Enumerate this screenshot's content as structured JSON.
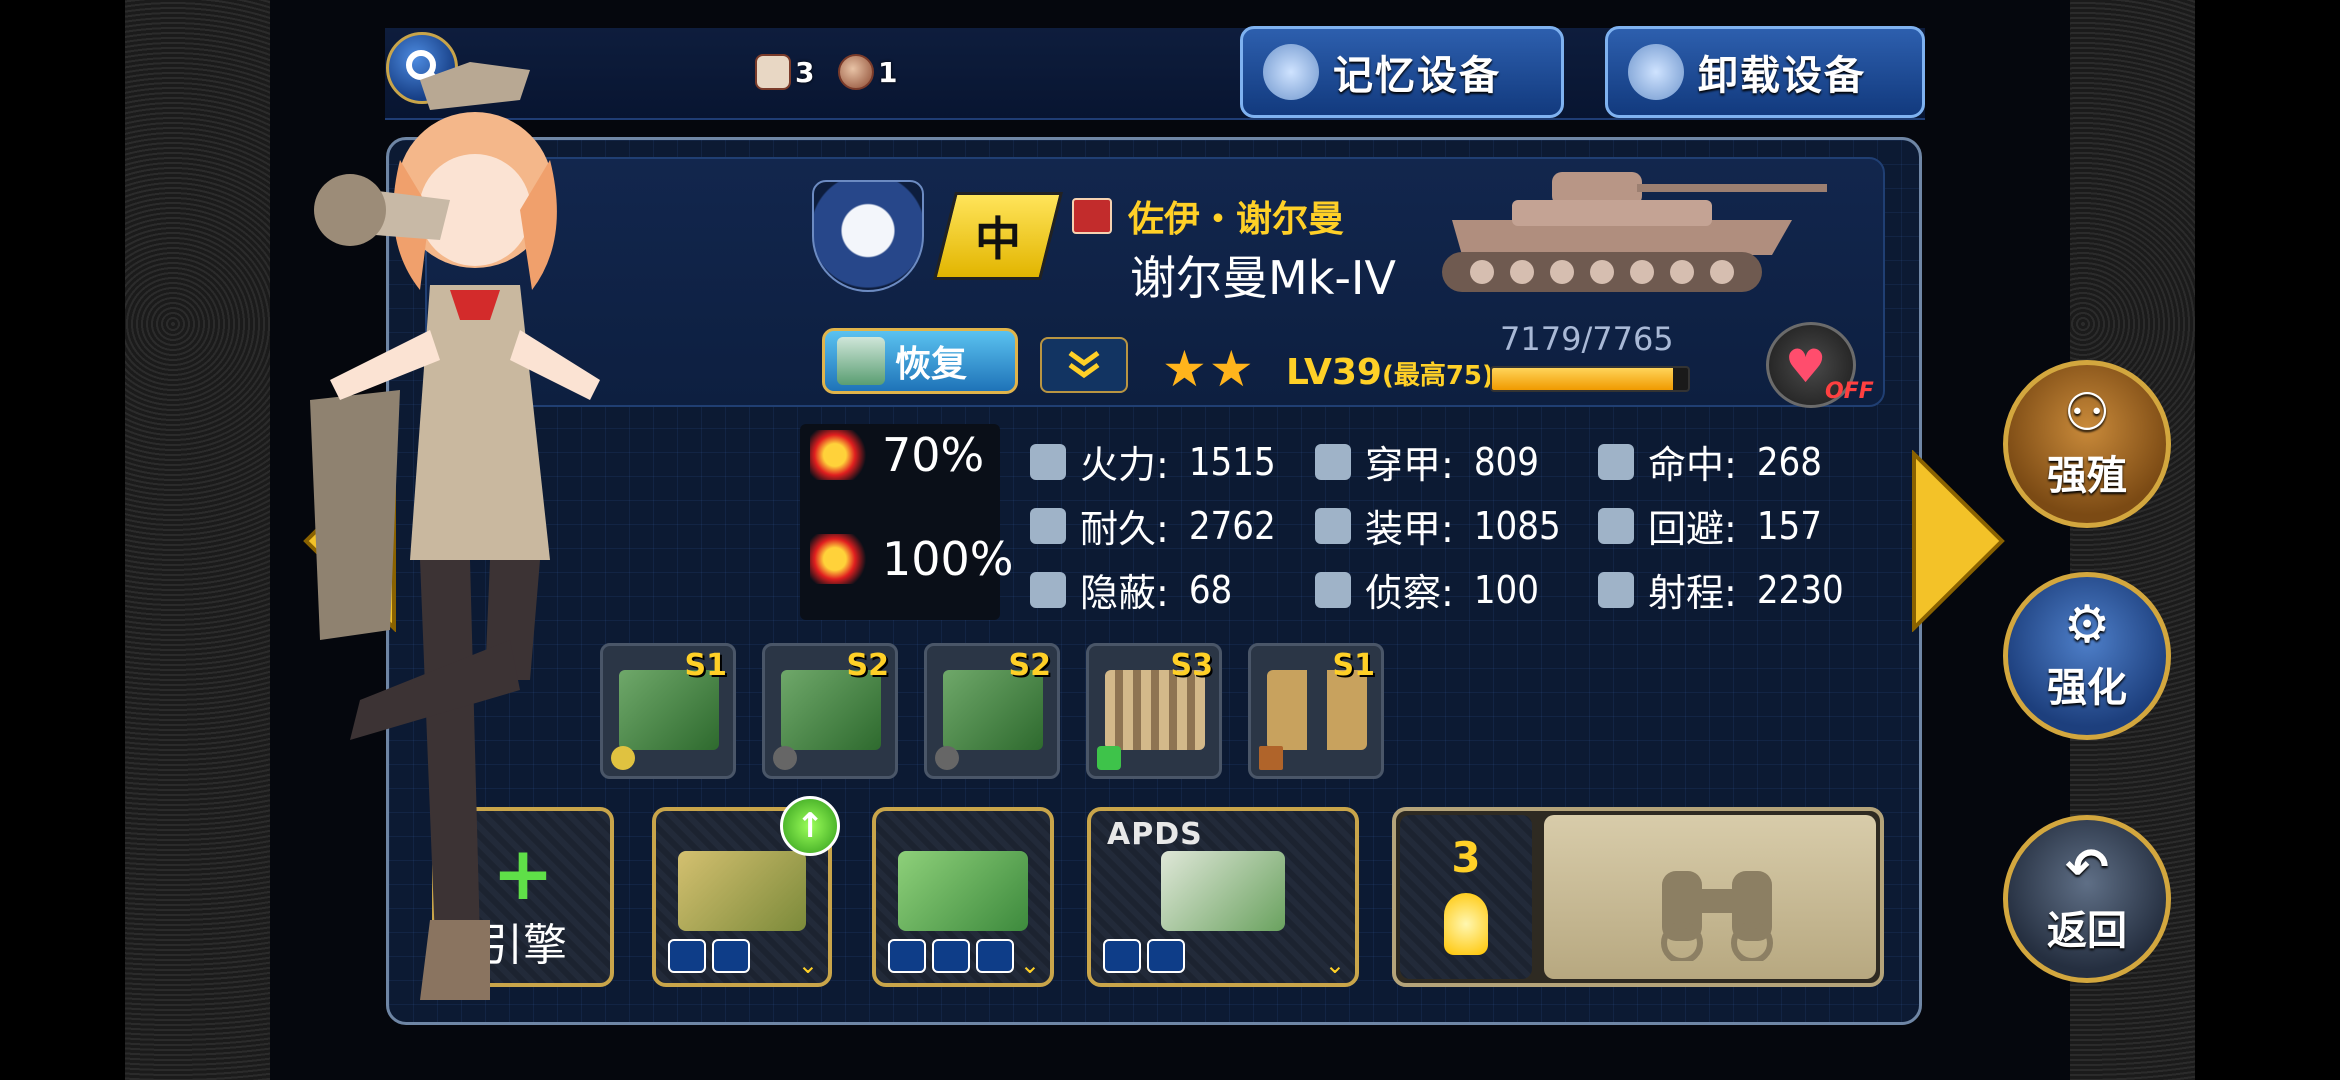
{
  "top": {
    "resource1_count": "3",
    "resource2_count": "1",
    "memory_btn": "记忆设备",
    "unload_btn": "卸载设备"
  },
  "unit": {
    "class_badge": "中",
    "name_sub": "佐伊・谢尔曼",
    "name_main": "谢尔曼Mk-IV",
    "restore_btn": "恢复",
    "stars": "★★",
    "level": "LV39",
    "level_max": "(最高75)",
    "exp_text": "7179/7765",
    "exp_fraction": 0.9245,
    "heart_status": "OFF"
  },
  "percent": {
    "p1": "70%",
    "p2": "100%"
  },
  "stats": [
    {
      "label": "火力:",
      "value": "1515"
    },
    {
      "label": "穿甲:",
      "value": "809"
    },
    {
      "label": "命中:",
      "value": "268"
    },
    {
      "label": "耐久:",
      "value": "2762"
    },
    {
      "label": "装甲:",
      "value": "1085"
    },
    {
      "label": "回避:",
      "value": "157"
    },
    {
      "label": "隐蔽:",
      "value": "68"
    },
    {
      "label": "侦察:",
      "value": "100"
    },
    {
      "label": "射程:",
      "value": "2230"
    }
  ],
  "parts": [
    {
      "rank": "S1"
    },
    {
      "rank": "S2"
    },
    {
      "rank": "S2"
    },
    {
      "rank": "S3"
    },
    {
      "rank": "S1"
    }
  ],
  "slots": {
    "engine_plus": "+",
    "engine_label": "引擎",
    "apds_label": "APDS",
    "chevron": "⌄",
    "upgrade_arrow": "↑",
    "w_count": "3"
  },
  "side_buttons": {
    "breed": "强殖",
    "enhance": "强化",
    "back": "返回"
  },
  "colors": {
    "accent_gold": "#c9a54a",
    "panel_bg": "#0c1a33",
    "level_yellow": "#ffd027"
  }
}
